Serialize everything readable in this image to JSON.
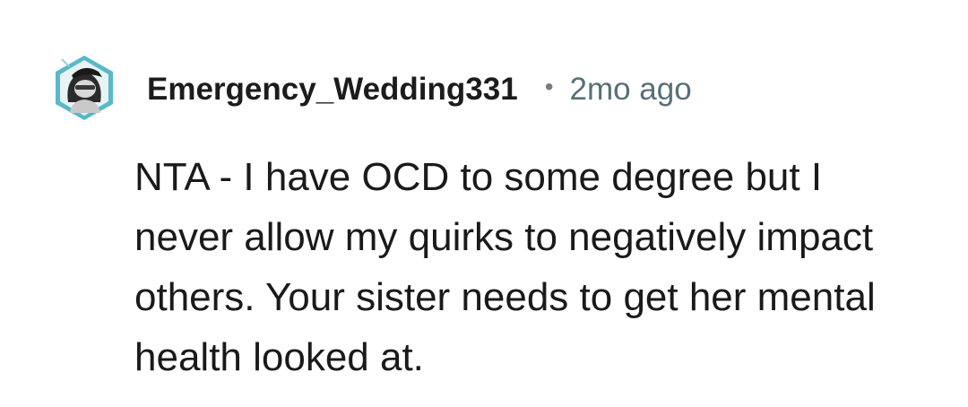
{
  "comment": {
    "author": "Emergency_Wedding331",
    "separator": "•",
    "timestamp": "2mo ago",
    "body": "NTA - I have OCD to some degree but I never allow my quirks to negatively impact others. Your sister needs to get her mental health looked at.",
    "avatar_icon": "user-avatar-icon"
  },
  "colors": {
    "username": "#1c1c1c",
    "timestamp": "#576f76",
    "body_text": "#1a1a1b",
    "avatar_ring": "#58b9c9",
    "background": "#ffffff"
  }
}
